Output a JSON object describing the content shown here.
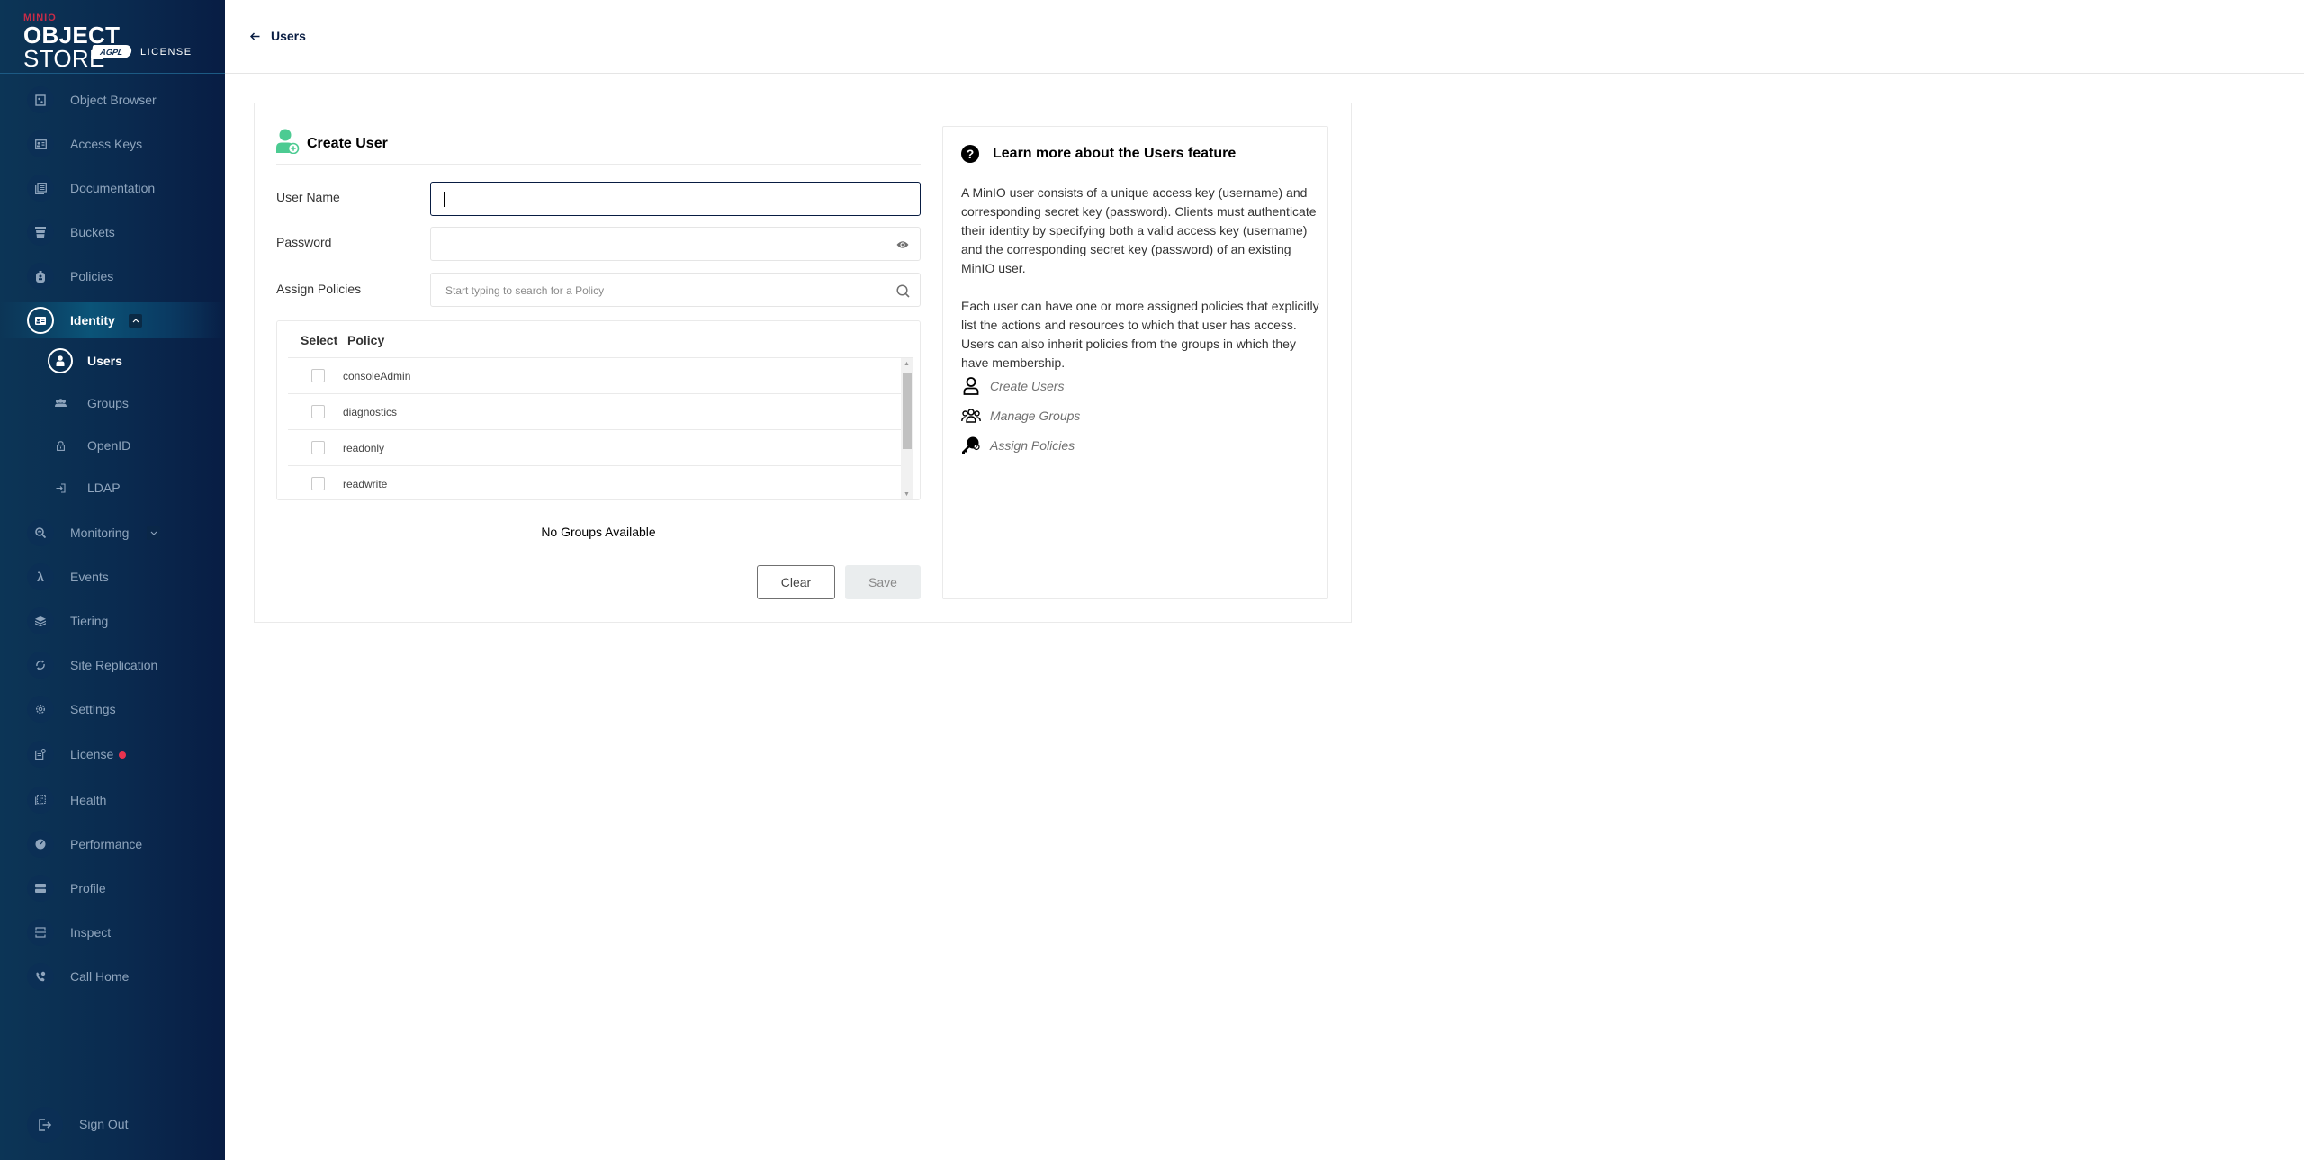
{
  "brand": {
    "top": "MINIO",
    "product_bold": "OBJECT",
    "product_light": "STORE",
    "badge": "AGPL",
    "license": "LICENSE",
    "accent": "#c72c48"
  },
  "sidebar": {
    "items": [
      {
        "label": "Object Browser",
        "icon": "object-browser-icon"
      },
      {
        "label": "Access Keys",
        "icon": "access-keys-icon"
      },
      {
        "label": "Documentation",
        "icon": "documentation-icon"
      },
      {
        "label": "Buckets",
        "icon": "buckets-icon"
      },
      {
        "label": "Policies",
        "icon": "policies-icon"
      },
      {
        "label": "Identity",
        "icon": "identity-icon",
        "expanded": true,
        "active": true
      },
      {
        "label": "Monitoring",
        "icon": "monitoring-icon",
        "expanded": false
      },
      {
        "label": "Events",
        "icon": "lambda-icon"
      },
      {
        "label": "Tiering",
        "icon": "tiering-icon"
      },
      {
        "label": "Site Replication",
        "icon": "site-replication-icon"
      },
      {
        "label": "Settings",
        "icon": "gear-icon"
      },
      {
        "label": "License",
        "icon": "license-icon",
        "alert": true
      },
      {
        "label": "Health",
        "icon": "health-icon"
      },
      {
        "label": "Performance",
        "icon": "performance-icon"
      },
      {
        "label": "Profile",
        "icon": "profile-icon"
      },
      {
        "label": "Inspect",
        "icon": "inspect-icon"
      },
      {
        "label": "Call Home",
        "icon": "call-home-icon"
      }
    ],
    "identity_sub": [
      {
        "label": "Users",
        "icon": "user-icon",
        "active": true
      },
      {
        "label": "Groups",
        "icon": "groups-icon"
      },
      {
        "label": "OpenID",
        "icon": "lock-icon"
      },
      {
        "label": "LDAP",
        "icon": "login-icon"
      }
    ],
    "sign_out": "Sign Out",
    "alert_color": "#e8334f"
  },
  "header": {
    "back_label": "Users"
  },
  "form": {
    "title": "Create User",
    "username_label": "User Name",
    "username_value": "",
    "password_label": "Password",
    "password_value": "",
    "policies_label": "Assign Policies",
    "policies_placeholder": "Start typing to search for a Policy",
    "table_headers": {
      "select": "Select",
      "policy": "Policy"
    },
    "policies": [
      {
        "name": "consoleAdmin",
        "checked": false
      },
      {
        "name": "diagnostics",
        "checked": false
      },
      {
        "name": "readonly",
        "checked": false
      },
      {
        "name": "readwrite",
        "checked": false
      }
    ],
    "no_groups": "No Groups Available",
    "clear_label": "Clear",
    "save_label": "Save",
    "icon_color": "#4ccb92"
  },
  "help": {
    "title": "Learn more about the Users feature",
    "para1": "A MinIO user consists of a unique access key (username) and corresponding secret key (password). Clients must authenticate their identity by specifying both a valid access key (username) and the corresponding secret key (password) of an existing MinIO user.",
    "para2": "Each user can have one or more assigned policies that explicitly list the actions and resources to which that user has access. Users can also inherit policies from the groups in which they have membership.",
    "links": [
      {
        "label": "Create Users",
        "icon": "user-outline-icon"
      },
      {
        "label": "Manage Groups",
        "icon": "groups-outline-icon"
      },
      {
        "label": "Assign Policies",
        "icon": "key-icon"
      }
    ]
  }
}
